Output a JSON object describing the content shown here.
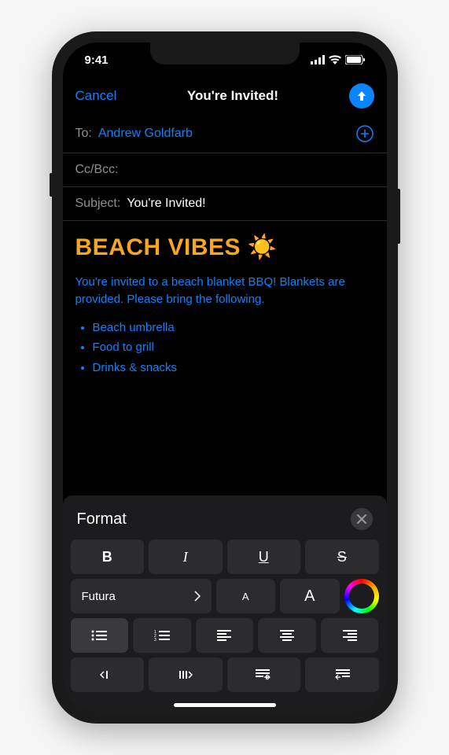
{
  "status": {
    "time": "9:41"
  },
  "header": {
    "cancel": "Cancel",
    "title": "You're Invited!"
  },
  "fields": {
    "to_label": "To:",
    "to_value": "Andrew Goldfarb",
    "ccbcc_label": "Cc/Bcc:",
    "subject_label": "Subject:",
    "subject_value": "You're Invited!"
  },
  "body": {
    "heading": "BEACH VIBES ☀️",
    "paragraph": "You're invited to a beach blanket BBQ! Blankets are provided. Please bring the following.",
    "list": [
      "Beach umbrella",
      "Food to grill",
      "Drinks & snacks"
    ]
  },
  "format": {
    "title": "Format",
    "bold": "B",
    "italic": "I",
    "underline": "U",
    "strike": "S",
    "font": "Futura",
    "size_small": "A",
    "size_large": "A"
  }
}
